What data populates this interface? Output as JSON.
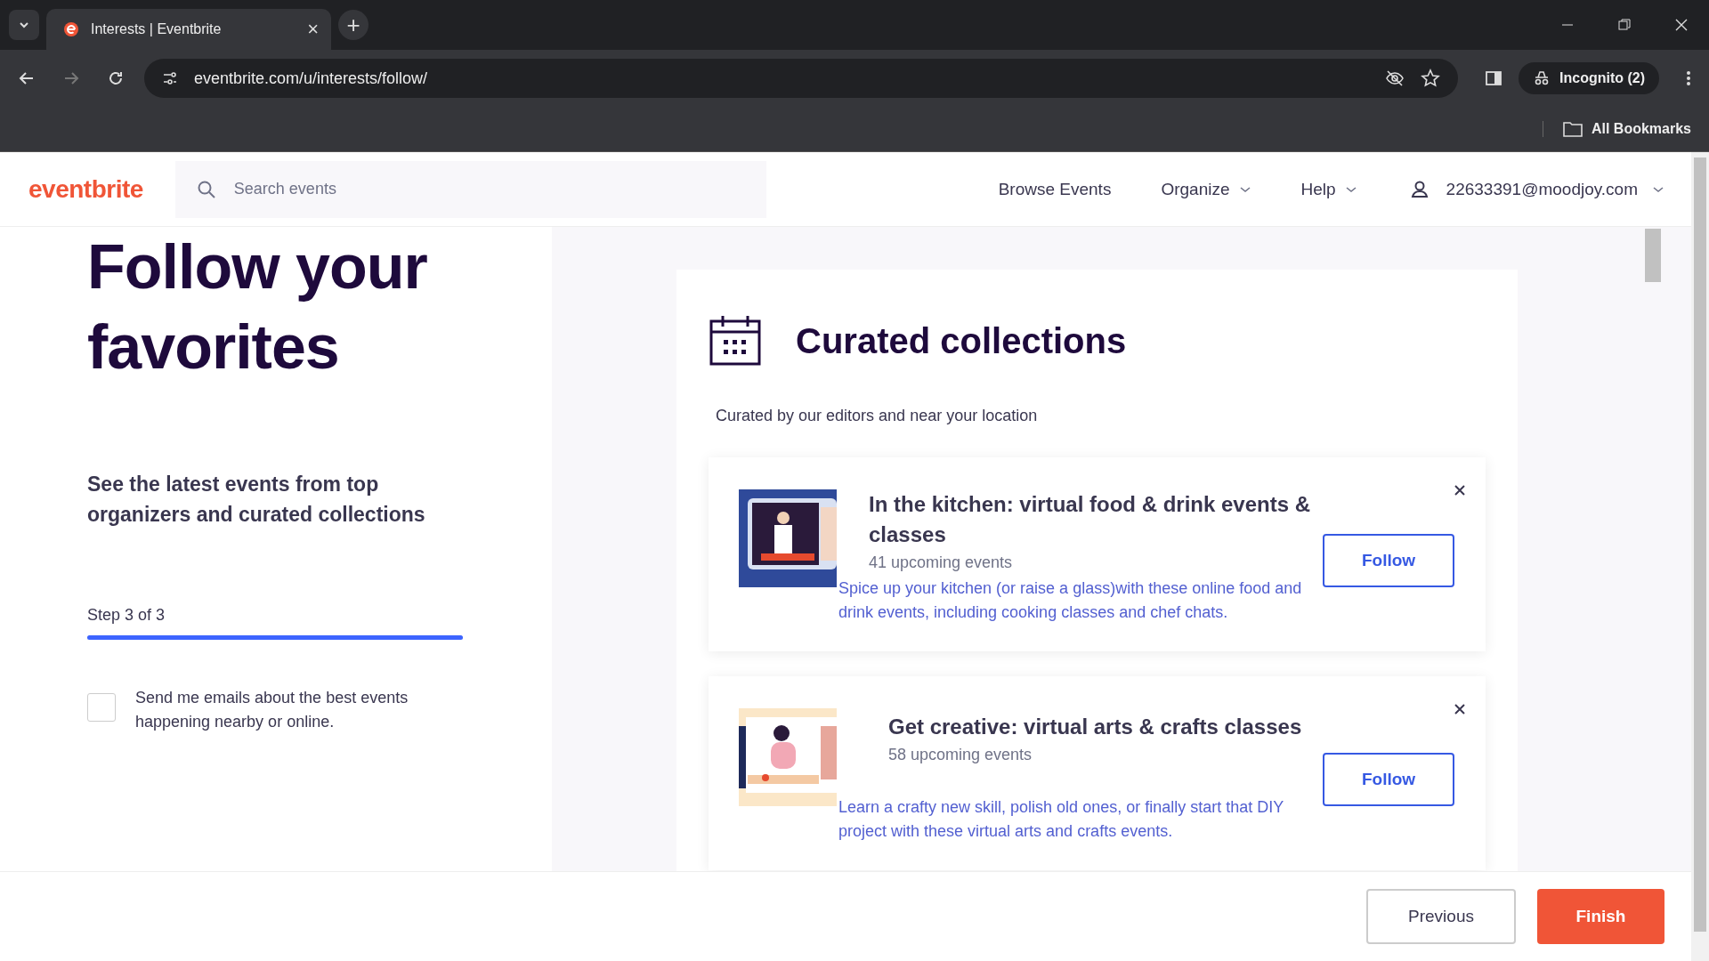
{
  "browser": {
    "tab": {
      "title": "Interests | Eventbrite",
      "close": "×"
    },
    "new_tab": "+",
    "url": "eventbrite.com/u/interests/follow/",
    "profile": "Incognito (2)",
    "bookmarks": "All Bookmarks"
  },
  "header": {
    "logo": "eventbrite",
    "search": {
      "placeholder": "Search events"
    },
    "nav": [
      {
        "label": "Browse Events",
        "dropdown": false
      },
      {
        "label": "Organize",
        "dropdown": true
      },
      {
        "label": "Help",
        "dropdown": true
      }
    ],
    "account": "22633391@moodjoy.com"
  },
  "left": {
    "title": "Follow your favorites",
    "subtitle": "See the latest events from top organizers and curated collections",
    "step": "Step 3 of 3",
    "progress": {
      "level": 1
    },
    "email_opt_in": {
      "label": "Send me emails about the best events happening nearby or online.",
      "checked": false
    }
  },
  "collections": {
    "title": "Curated collections",
    "subtitle": "Curated by our editors and near your location",
    "items": [
      {
        "title": "In the kitchen: virtual food & drink events & classes",
        "count": "41 upcoming events",
        "description": "Spice up your kitchen (or raise a glass)with these online food and drink events, including cooking classes and chef chats.",
        "button": "Follow",
        "kind": "kitchen"
      },
      {
        "title": "Get creative: virtual arts & crafts classes",
        "count": "58 upcoming events",
        "description": "Learn a crafty new skill, polish old ones, or finally start that DIY project with these virtual arts and crafts events.",
        "button": "Follow",
        "kind": "crafts"
      }
    ]
  },
  "footer": {
    "buttons": [
      {
        "label": "Previous",
        "kind": "secondary"
      },
      {
        "label": "Finish",
        "kind": "primary"
      }
    ]
  }
}
